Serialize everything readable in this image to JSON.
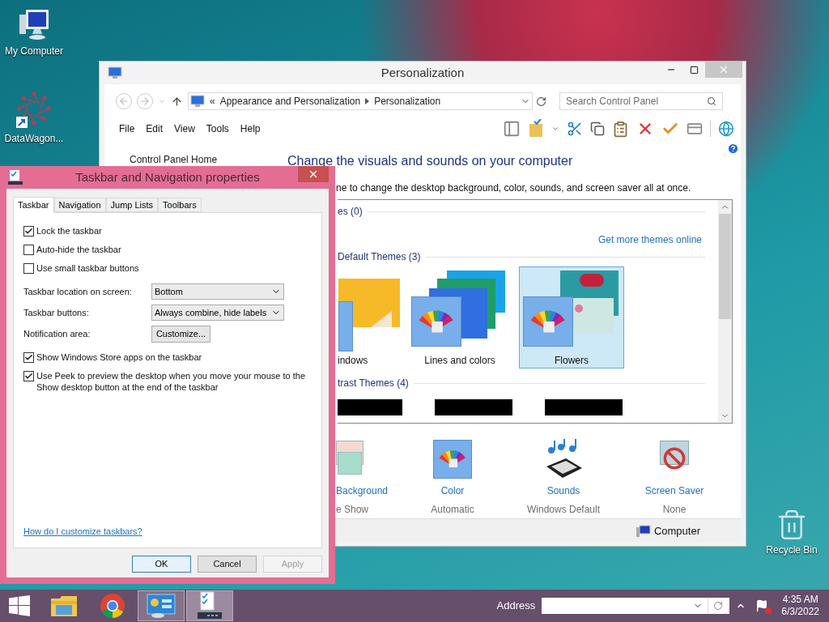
{
  "desktop_icons": [
    {
      "kind": "computer",
      "label": "My Computer"
    },
    {
      "kind": "shortcut",
      "label": "DataWagon..."
    },
    {
      "kind": "recycle",
      "label": "Recycle Bin"
    }
  ],
  "personalization": {
    "title": "Personalization",
    "address_prefix": "«",
    "crumbs": [
      "Appearance and Personalization",
      "Personalization"
    ],
    "search_placeholder": "Search Control Panel",
    "menu": [
      "File",
      "Edit",
      "View",
      "Tools",
      "Help"
    ],
    "sidebar_link": "Control Panel Home",
    "heading": "Change the visuals and sounds on your computer",
    "description": "ne to change the desktop background, color, sounds, and screen saver all at once.",
    "themes": {
      "my_heading": "es (0)",
      "online_link": "Get more themes online",
      "default_heading": "Default Themes (3)",
      "default_themes": [
        {
          "kind": "windows",
          "name": "indows",
          "selected": false
        },
        {
          "kind": "lines",
          "name": "Lines and colors",
          "selected": false
        },
        {
          "kind": "flowers",
          "name": "Flowers",
          "selected": true
        }
      ],
      "contrast_heading": "trast Themes (4)"
    },
    "settings": [
      {
        "kind": "background",
        "label": "Background",
        "value": "e Show"
      },
      {
        "kind": "color",
        "label": "Color",
        "value": "Automatic"
      },
      {
        "kind": "sounds",
        "label": "Sounds",
        "value": "Windows Default"
      },
      {
        "kind": "screensaver",
        "label": "Screen Saver",
        "value": "None"
      }
    ],
    "status": "Computer"
  },
  "dialog": {
    "title": "Taskbar and Navigation properties",
    "tabs": [
      {
        "label": "Taskbar",
        "selected": true
      },
      {
        "label": "Navigation",
        "selected": false
      },
      {
        "label": "Jump Lists",
        "selected": false
      },
      {
        "label": "Toolbars",
        "selected": false
      }
    ],
    "options": [
      {
        "kind": "checkbox",
        "label": "Lock the taskbar",
        "checked": true
      },
      {
        "kind": "checkbox",
        "label": "Auto-hide the taskbar",
        "checked": false
      },
      {
        "kind": "checkbox",
        "label": "Use small taskbar buttons",
        "checked": false
      },
      {
        "kind": "select",
        "label": "Taskbar location on screen:",
        "value": "Bottom"
      },
      {
        "kind": "select",
        "label": "Taskbar buttons:",
        "value": "Always combine, hide labels"
      },
      {
        "kind": "button",
        "label": "Notification area:",
        "value": "Customize..."
      },
      {
        "kind": "checkbox",
        "label": "Show Windows Store apps on the taskbar",
        "checked": true
      },
      {
        "kind": "checkbox",
        "label": "Use Peek to preview the desktop when you move your mouse to the Show desktop button at the end of the taskbar",
        "checked": true
      }
    ],
    "help_link": "How do I customize taskbars?",
    "buttons": [
      {
        "label": "OK",
        "default": true,
        "disabled": false
      },
      {
        "label": "Cancel",
        "default": false,
        "disabled": false
      },
      {
        "label": "Apply",
        "default": false,
        "disabled": true
      }
    ]
  },
  "taskbar": {
    "apps": [
      {
        "kind": "start",
        "open": false,
        "selected": false
      },
      {
        "kind": "explorer",
        "open": false,
        "selected": false
      },
      {
        "kind": "browser",
        "open": false,
        "selected": false
      },
      {
        "kind": "control-panel",
        "open": true,
        "selected": false
      },
      {
        "kind": "properties",
        "open": true,
        "selected": true
      }
    ],
    "address_label": "Address",
    "time": "4:35 AM",
    "date": "6/3/2022"
  }
}
